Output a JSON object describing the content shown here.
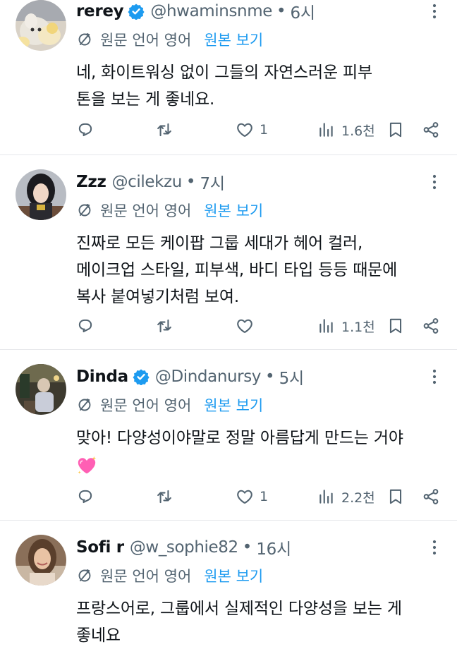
{
  "translate_label": "원문 언어 영어",
  "view_original_label": "원본 보기",
  "tweets": [
    {
      "name": "rerey",
      "verified": true,
      "handle": "@hwaminsnme",
      "time": "6시",
      "body_lines": [
        "네, 화이트워싱 없이 그들의 자연스러운 피부",
        "톤을 보는 게 좋네요."
      ],
      "likes": "1",
      "views": "1.6천"
    },
    {
      "name": "Zzz",
      "verified": false,
      "handle": "@cilekzu",
      "time": "7시",
      "body_lines": [
        "진짜로 모든 케이팝 그룹 세대가 헤어 컬러,",
        "메이크업 스타일, 피부색, 바디 타입 등등 때문에",
        "복사 붙여넣기처럼 보여."
      ],
      "likes": "",
      "views": "1.1천"
    },
    {
      "name": "Dinda",
      "verified": true,
      "handle": "@Dindanursy",
      "time": "5시",
      "body_lines": [
        "맞아! 다양성이야말로 정말 아름답게 만드는 거야"
      ],
      "emoji": "sparkling-heart",
      "likes": "1",
      "views": "2.2천"
    },
    {
      "name": "Sofi r",
      "verified": false,
      "handle": "@w_sophie82",
      "time": "16시",
      "body_lines": [
        "프랑스어로, 그룹에서 실제적인 다양성을 보는 게",
        "좋네요"
      ]
    }
  ],
  "colors": {
    "accent": "#1d9bf0",
    "secondary_text": "#536471",
    "divider": "#e6e8eb",
    "emoji_heart": "#ff5fb4"
  }
}
